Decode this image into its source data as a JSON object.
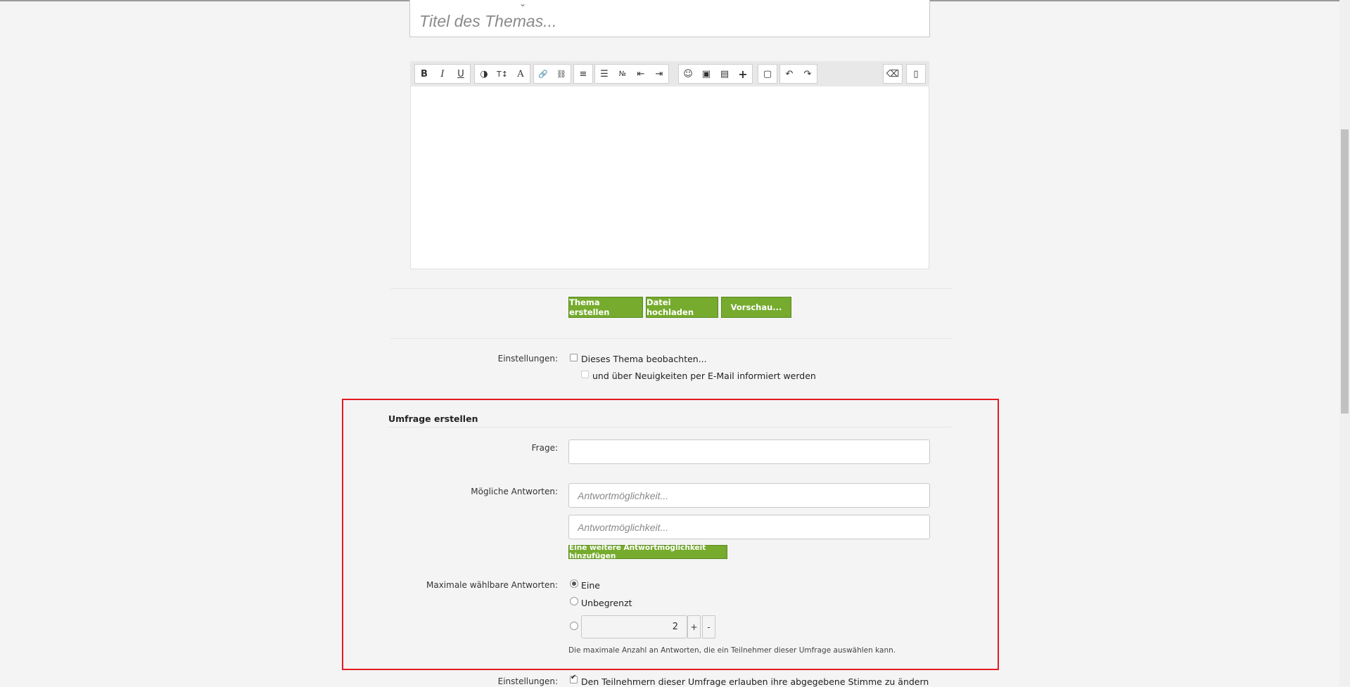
{
  "title_input": {
    "placeholder": "Titel des Themas..."
  },
  "toolbar": {
    "groups": [
      [
        "B",
        "I",
        "U"
      ],
      [
        "◑",
        "T↕",
        "A"
      ],
      [
        "🔗",
        "⛓"
      ],
      [
        "≡"
      ],
      [
        "☰",
        "№",
        "⇤",
        "⇥"
      ],
      [
        "☺",
        "▣",
        "▤",
        "+"
      ],
      [
        "▢"
      ],
      [
        "↶",
        "↷"
      ]
    ],
    "right_groups": [
      [
        "⌫"
      ],
      [
        "▯"
      ]
    ]
  },
  "actions": {
    "create_label": "Thema erstellen",
    "upload_label": "Datei hochladen",
    "preview_label": "Vorschau..."
  },
  "settings": {
    "label": "Einstellungen:",
    "watch_label": "Dieses Thema beobachten...",
    "email_label": "und über Neuigkeiten per E-Mail informiert werden"
  },
  "poll": {
    "heading": "Umfrage erstellen",
    "question_label": "Frage:",
    "answers_label": "Mögliche Antworten:",
    "answer_placeholder": "Antwortmöglichkeit...",
    "add_answer_label": "Eine weitere Antwortmöglichkeit hinzufügen",
    "max_label": "Maximale wählbare Antworten:",
    "opt_one": "Eine",
    "opt_unlimited": "Unbegrenzt",
    "stepper_value": "2",
    "plus": "+",
    "minus": "-",
    "hint": "Die maximale Anzahl an Antworten, die ein Teilnehmer dieser Umfrage auswählen kann."
  },
  "poll_settings": {
    "label": "Einstellungen:",
    "allow_change_label": "Den Teilnehmern dieser Umfrage erlauben ihre abgegebene Stimme zu ändern"
  },
  "colors": {
    "button_green": "#76ab2e",
    "highlight_red": "#e41b23"
  }
}
